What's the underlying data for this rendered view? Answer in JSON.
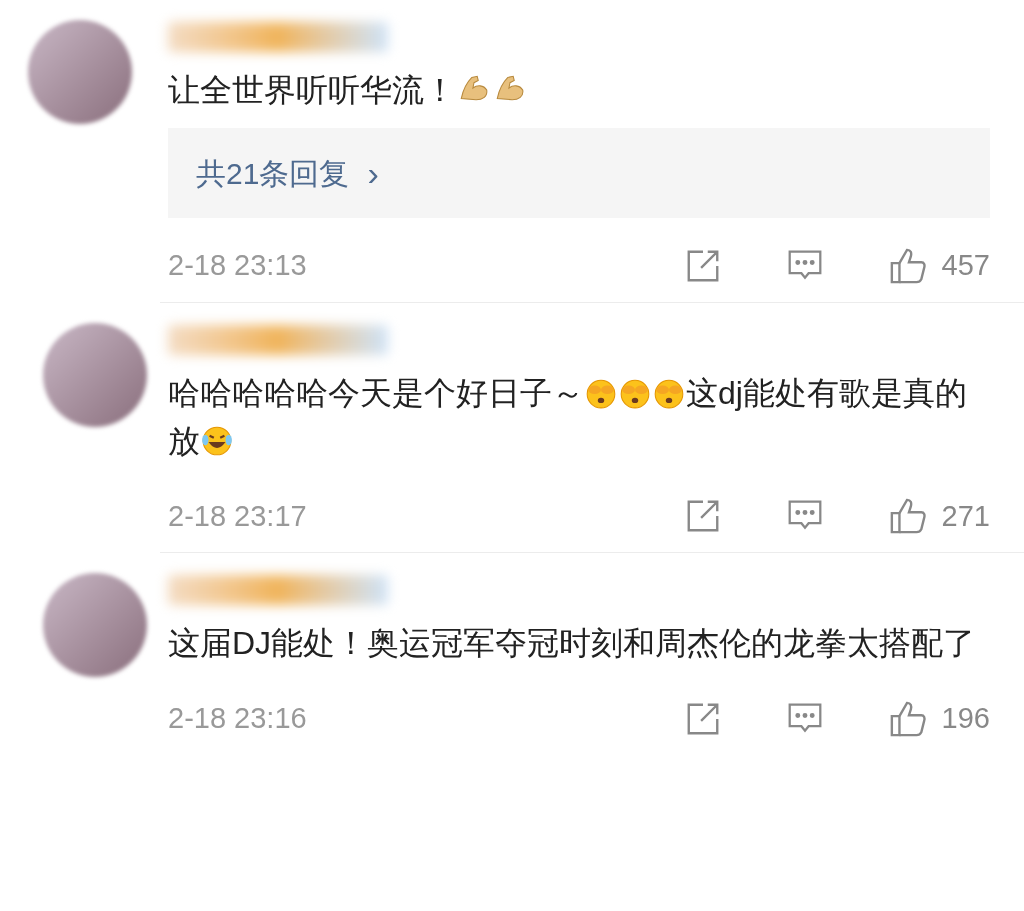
{
  "comments": [
    {
      "content": [
        {
          "kind": "text",
          "text": "让全世界听听华流！"
        },
        {
          "kind": "flex"
        },
        {
          "kind": "flex"
        }
      ],
      "replies": "共21条回复",
      "reply_arrow": "›",
      "time": "2-18 23:13",
      "likes": "457"
    },
    {
      "content": [
        {
          "kind": "text",
          "text": "哈哈哈哈哈今天是个好日子～"
        },
        {
          "kind": "cover"
        },
        {
          "kind": "cover"
        },
        {
          "kind": "cover"
        },
        {
          "kind": "text",
          "text": "这dj能处有歌是真的放"
        },
        {
          "kind": "laugh"
        }
      ],
      "time": "2-18 23:17",
      "likes": "271"
    },
    {
      "content": [
        {
          "kind": "text",
          "text": "这届DJ能处！奥运冠军夺冠时刻和周杰伦的龙拳太搭配了"
        }
      ],
      "time": "2-18 23:16",
      "likes": "196"
    }
  ]
}
